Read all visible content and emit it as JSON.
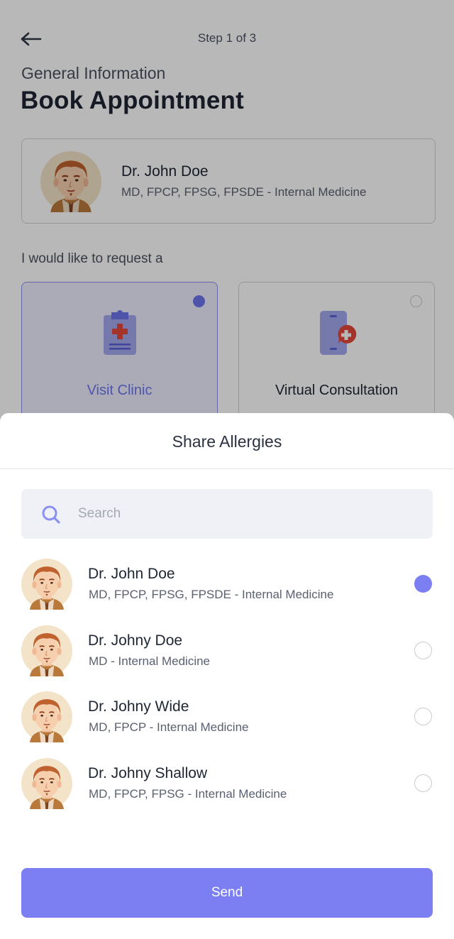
{
  "header": {
    "step": "Step 1 of 3",
    "subtitle": "General Information",
    "title": "Book Appointment"
  },
  "doctor_card": {
    "name": "Dr. John Doe",
    "credentials": "MD, FPCP, FPSG, FPSDE - Internal Medicine"
  },
  "request": {
    "label": "I would like to request a",
    "options": [
      {
        "label": "Visit Clinic",
        "icon": "clipboard-medical-icon",
        "selected": true
      },
      {
        "label": "Virtual Consultation",
        "icon": "phone-medical-chat-icon",
        "selected": false
      }
    ]
  },
  "sheet": {
    "title": "Share Allergies",
    "search_placeholder": "Search",
    "doctors": [
      {
        "name": "Dr. John Doe",
        "credentials": "MD, FPCP, FPSG, FPSDE - Internal Medicine",
        "selected": true
      },
      {
        "name": "Dr. Johny Doe",
        "credentials": "MD - Internal Medicine",
        "selected": false
      },
      {
        "name": "Dr. Johny Wide",
        "credentials": "MD, FPCP - Internal Medicine",
        "selected": false
      },
      {
        "name": "Dr. Johny Shallow",
        "credentials": "MD, FPCP, FPSG - Internal Medicine",
        "selected": false
      }
    ],
    "send_label": "Send"
  },
  "colors": {
    "accent": "#7b7ff2",
    "accent_dark": "#6e75ee",
    "title_text": "#1e2533",
    "muted_text": "#5a6070",
    "search_bg": "#f0f1f6"
  }
}
